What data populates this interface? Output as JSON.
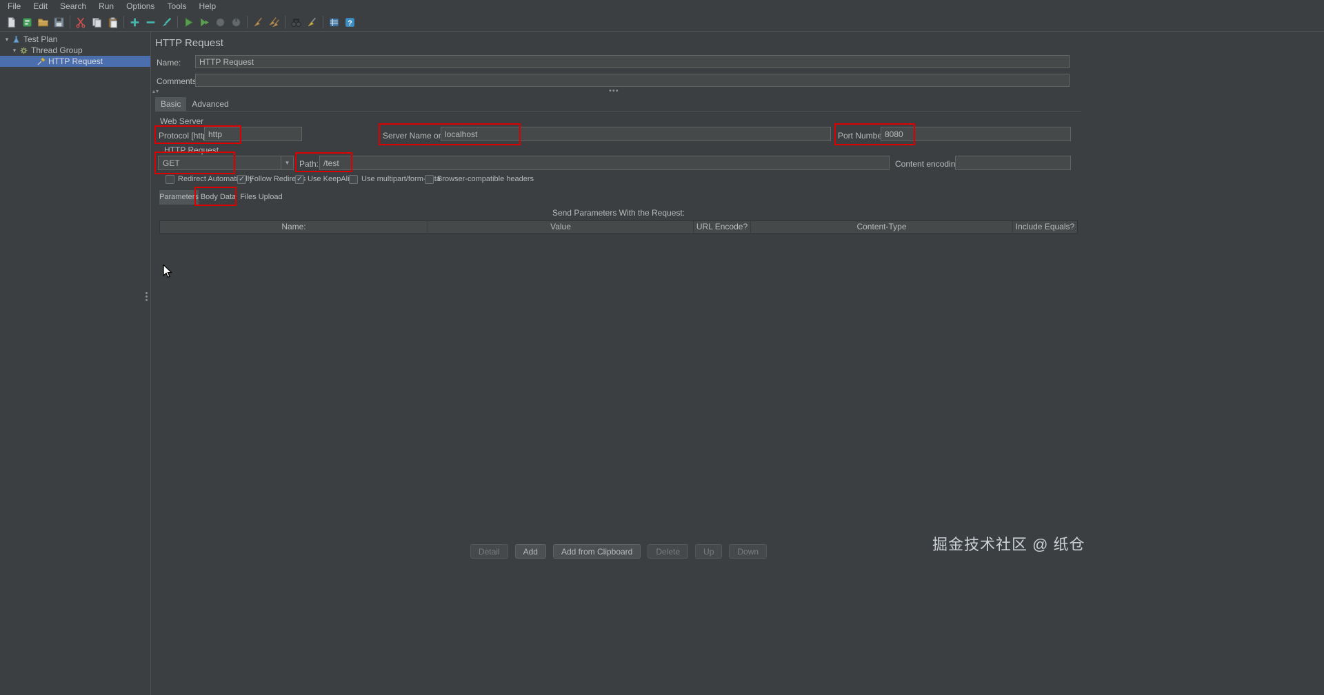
{
  "menu": {
    "items": [
      "File",
      "Edit",
      "Search",
      "Run",
      "Options",
      "Tools",
      "Help"
    ]
  },
  "toolbar": {
    "icons": [
      "new-file",
      "templates",
      "open",
      "save",
      "cut",
      "copy",
      "paste",
      "expand-all",
      "collapse-all",
      "toggle",
      "start",
      "start-no-pauses",
      "stop",
      "shutdown",
      "clear",
      "clear-all",
      "search",
      "search-reset",
      "function-helper",
      "help"
    ]
  },
  "tree": {
    "items": [
      {
        "label": "Test Plan",
        "selected": false
      },
      {
        "label": "Thread Group",
        "selected": false
      },
      {
        "label": "HTTP Request",
        "selected": true
      }
    ]
  },
  "main": {
    "title": "HTTP Request",
    "name_label": "Name:",
    "name_value": "HTTP Request",
    "comments_label": "Comments:",
    "comments_value": "",
    "tabs": [
      {
        "label": "Basic",
        "selected": true
      },
      {
        "label": "Advanced",
        "selected": false
      }
    ],
    "web_server": {
      "group_label": "Web Server",
      "protocol_label": "Protocol [http]:",
      "protocol_value": "http",
      "server_label": "Server Name or IP:",
      "server_value": "localhost",
      "port_label": "Port Number:",
      "port_value": "8080"
    },
    "http_request": {
      "group_label": "HTTP Request",
      "method_value": "GET",
      "path_label": "Path:",
      "path_value": "/test",
      "content_encoding_label": "Content encoding:",
      "content_encoding_value": "",
      "checkboxes": [
        {
          "label": "Redirect Automatically",
          "checked": false
        },
        {
          "label": "Follow Redirects",
          "checked": true
        },
        {
          "label": "Use KeepAlive",
          "checked": true
        },
        {
          "label": "Use multipart/form-data",
          "checked": false
        },
        {
          "label": "Browser-compatible headers",
          "checked": false
        }
      ]
    },
    "params_tabs": [
      {
        "label": "Parameters",
        "selected": true
      },
      {
        "label": "Body Data",
        "selected": false
      },
      {
        "label": "Files Upload",
        "selected": false
      }
    ],
    "params_table": {
      "caption": "Send Parameters With the Request:",
      "headers": [
        "Name:",
        "Value",
        "URL Encode?",
        "Content-Type",
        "Include Equals?"
      ],
      "rows": []
    },
    "buttons": [
      {
        "label": "Detail",
        "enabled": false
      },
      {
        "label": "Add",
        "enabled": true
      },
      {
        "label": "Add from Clipboard",
        "enabled": true
      },
      {
        "label": "Delete",
        "enabled": false
      },
      {
        "label": "Up",
        "enabled": false
      },
      {
        "label": "Down",
        "enabled": false
      }
    ]
  },
  "annotations": {
    "highlight_color": "#dd0000",
    "boxes": [
      "protocol-field",
      "server-name-field",
      "port-number-field",
      "method-select",
      "path-field",
      "body-data-tab"
    ]
  },
  "watermark": "掘金技术社区 @ 纸仓"
}
